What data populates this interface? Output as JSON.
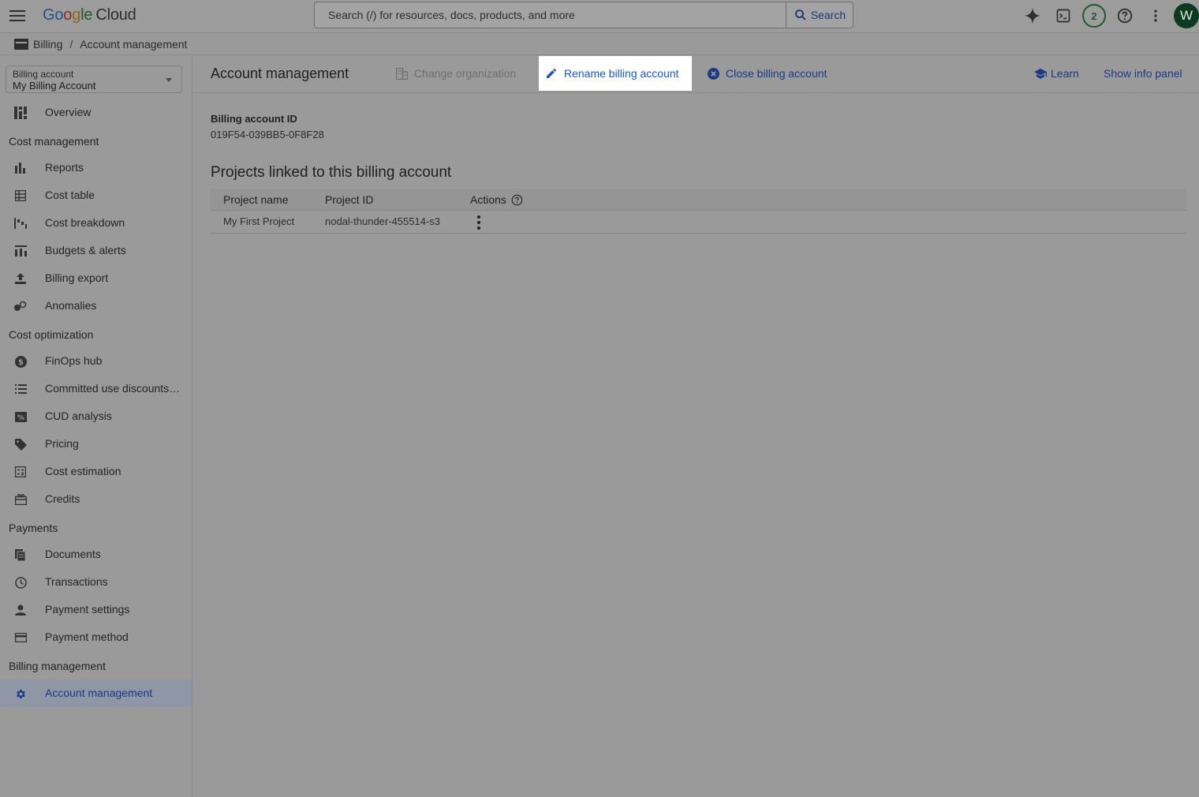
{
  "header": {
    "logo": {
      "g1": "Go",
      "g2": "o",
      "g3": "g",
      "g4": "le",
      "cloud": "Cloud"
    },
    "search_placeholder": "Search (/) for resources, docs, products, and more",
    "search_button": "Search",
    "notifications_count": "2",
    "avatar_initial": "W"
  },
  "breadcrumb": {
    "items": [
      "Billing",
      "Account management"
    ],
    "separator": "/"
  },
  "sidebar": {
    "account_select": {
      "label": "Billing account",
      "value": "My Billing Account"
    },
    "overview": "Overview",
    "sections": {
      "cost_management": "Cost management",
      "cost_optimization": "Cost optimization",
      "payments": "Payments",
      "billing_management": "Billing management"
    },
    "items": {
      "reports": "Reports",
      "cost_table": "Cost table",
      "cost_breakdown": "Cost breakdown",
      "budgets": "Budgets & alerts",
      "billing_export": "Billing export",
      "anomalies": "Anomalies",
      "finops": "FinOps hub",
      "cud": "Committed use discounts…",
      "cud_analysis": "CUD analysis",
      "pricing": "Pricing",
      "cost_estimation": "Cost estimation",
      "credits": "Credits",
      "documents": "Documents",
      "transactions": "Transactions",
      "payment_settings": "Payment settings",
      "payment_method": "Payment method",
      "account_management": "Account management"
    }
  },
  "toolbar": {
    "title": "Account management",
    "change_org": "Change organization",
    "rename": "Rename billing account",
    "close": "Close billing account",
    "learn": "Learn",
    "info_panel": "Show info panel"
  },
  "content": {
    "id_label": "Billing account ID",
    "id_value": "019F54-039BB5-0F8F28",
    "projects_title": "Projects linked to this billing account",
    "columns": [
      "Project name",
      "Project ID",
      "Actions"
    ],
    "rows": [
      {
        "name": "My First Project",
        "id": "nodal-thunder-455514-s3"
      }
    ]
  },
  "colors": {
    "accent": "#1a57c9",
    "active_nav_bg": "#8f97a6",
    "backdrop": "#9a9a9a"
  }
}
